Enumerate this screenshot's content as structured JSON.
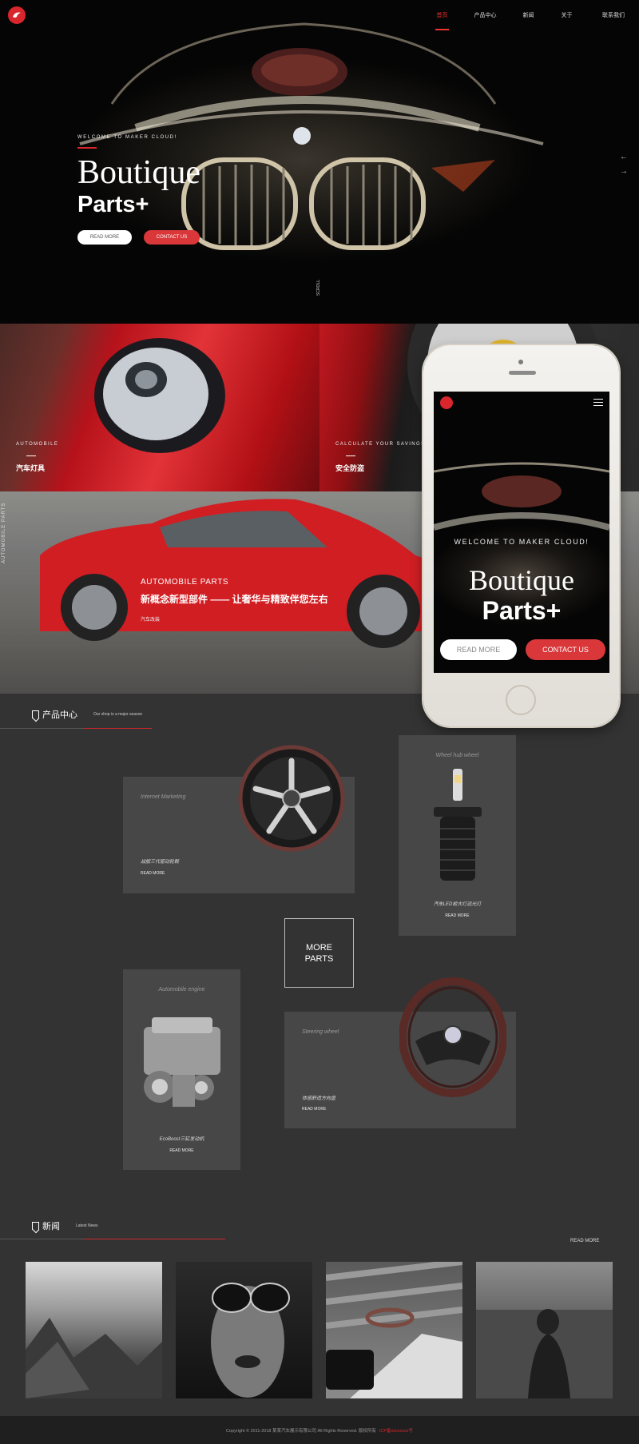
{
  "nav": {
    "items": [
      "首页",
      "产品中心",
      "新闻",
      "关于",
      "联系我们"
    ],
    "active_index": 0,
    "accent_color": "#d8262c"
  },
  "hero": {
    "welcome": "WELCOME TO MAKER CLOUD!",
    "title": "Boutique",
    "subtitle": "Parts+",
    "read_more": "READ MORE",
    "contact": "CONTACT US",
    "scroll": "SCROLL",
    "arrows": [
      "←",
      "→"
    ]
  },
  "features": {
    "panel1": {
      "label": "AUTOMOBILE",
      "title": "汽车灯具"
    },
    "panel2": {
      "label": "CALCULATE YOUR SAVINGS",
      "title": "安全防盗"
    },
    "panel3": {
      "label": "AUTOMOBILE PARTS",
      "title": "新概念新型部件 —— 让奢华与精致伴您左右",
      "sub": "汽车改装",
      "side": "AUTOMOBILE PARTS"
    }
  },
  "phone": {
    "welcome": "WELCOME TO MAKER CLOUD!",
    "title": "Boutique",
    "subtitle": "Parts+",
    "read_more": "READ MORE",
    "contact": "CONTACT US"
  },
  "products": {
    "heading": "产品中心",
    "desc": "Our shop is a major season",
    "cards": [
      {
        "title": "Internet Marketing",
        "desc": "战舰三代驱动轮毂",
        "more": "READ MORE"
      },
      {
        "title": "Wheel hub wheel",
        "desc": "汽车LED前大灯远光灯",
        "more": "READ MORE"
      },
      {
        "title": "Automobile engine",
        "desc": "EcoBoost三缸发动机",
        "more": "READ MORE"
      },
      {
        "title": "Steering wheel",
        "desc": "体感舒适方向盘",
        "more": "READ MORE"
      }
    ],
    "more_parts": [
      "MORE",
      "PARTS"
    ]
  },
  "news": {
    "heading": "新闻",
    "desc": "Latest News",
    "read_more": "READ MORE"
  },
  "footer": {
    "copyright": "Copyright © 2011-2018 某某汽车展示有限公司 All Rights Reserved. 版权所有",
    "icp": "ICP备xxxxxxxx号"
  }
}
